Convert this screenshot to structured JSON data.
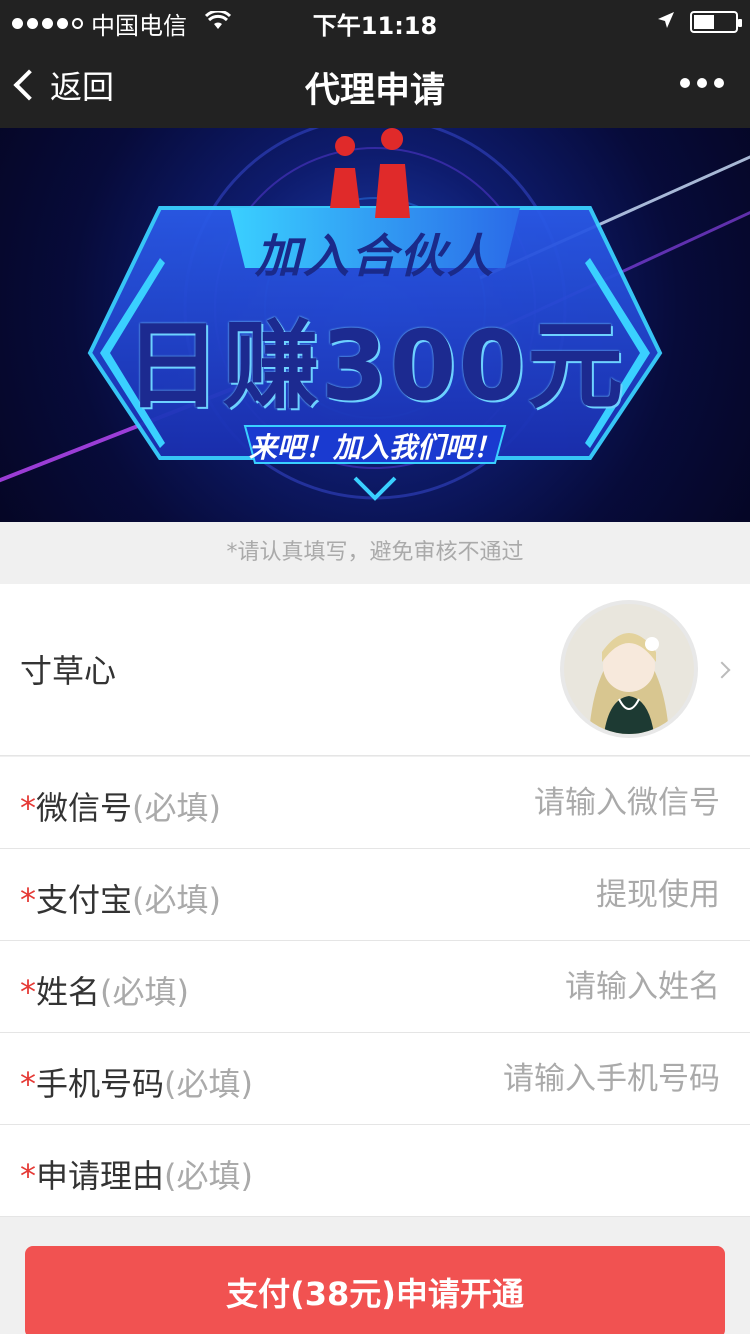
{
  "status_bar": {
    "carrier": "中国电信",
    "time": "下午11:18"
  },
  "nav": {
    "back_label": "返回",
    "title": "代理申请"
  },
  "banner": {
    "line1": "加入合伙人",
    "line2": "日赚300元",
    "line3": "来吧！加入我们吧！"
  },
  "hint": "*请认真填写，避免审核不通过",
  "profile": {
    "name": "寸草心"
  },
  "form": {
    "required_mark": "*",
    "fields": [
      {
        "label": "微信号",
        "note": "(必填)",
        "placeholder": "请输入微信号"
      },
      {
        "label": "支付宝",
        "note": "(必填)",
        "placeholder": "提现使用"
      },
      {
        "label": "姓名",
        "note": "(必填)",
        "placeholder": "请输入姓名"
      },
      {
        "label": "手机号码",
        "note": "(必填)",
        "placeholder": "请输入手机号码"
      },
      {
        "label": "申请理由",
        "note": "(必填)",
        "placeholder": ""
      }
    ]
  },
  "pay_button": {
    "label": "支付(38元)申请开通"
  },
  "colors": {
    "nav_bg": "#222222",
    "required": "#e53935",
    "button": "#f15251"
  }
}
